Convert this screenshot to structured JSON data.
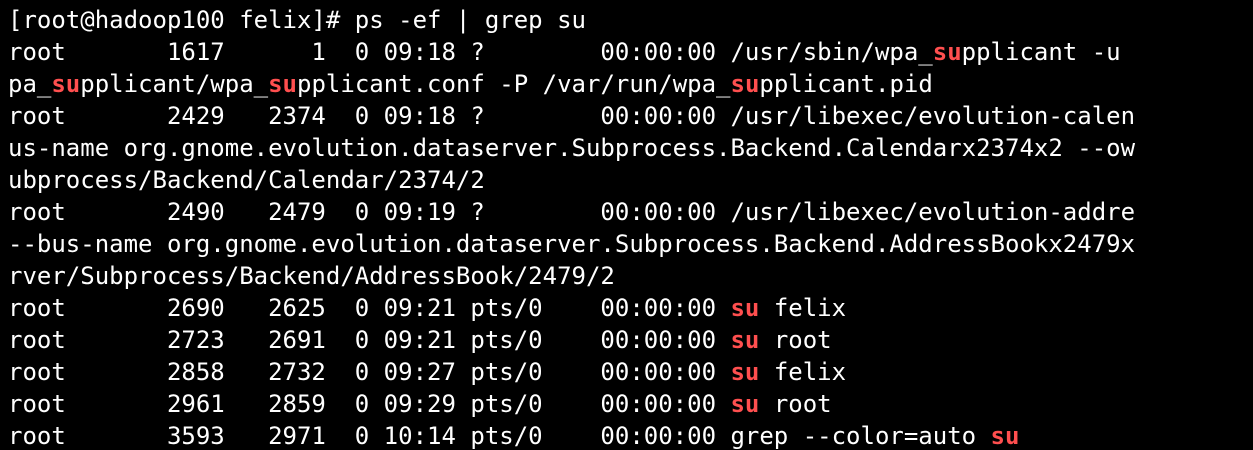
{
  "terminal": {
    "background_color": "#000000",
    "text_color": "#ffffff",
    "match_color": "#ff4f4f",
    "lines": [
      [
        {
          "t": "[root@hadoop100 felix]# ps -ef | grep su"
        }
      ],
      [
        {
          "t": "root       1617      1  0 09:18 ?        00:00:00 /usr/sbin/wpa_"
        },
        {
          "t": "su",
          "m": true
        },
        {
          "t": "pplicant -u"
        }
      ],
      [
        {
          "t": "pa_"
        },
        {
          "t": "su",
          "m": true
        },
        {
          "t": "pplicant/wpa_"
        },
        {
          "t": "su",
          "m": true
        },
        {
          "t": "pplicant.conf -P /var/run/wpa_"
        },
        {
          "t": "su",
          "m": true
        },
        {
          "t": "pplicant.pid"
        }
      ],
      [
        {
          "t": "root       2429   2374  0 09:18 ?        00:00:00 /usr/libexec/evolution-calen"
        }
      ],
      [
        {
          "t": "us-name org.gnome.evolution.dataserver.Subprocess.Backend.Calendarx2374x2 --ow"
        }
      ],
      [
        {
          "t": "ubprocess/Backend/Calendar/2374/2"
        }
      ],
      [
        {
          "t": "root       2490   2479  0 09:19 ?        00:00:00 /usr/libexec/evolution-addre"
        }
      ],
      [
        {
          "t": "--bus-name org.gnome.evolution.dataserver.Subprocess.Backend.AddressBookx2479x"
        }
      ],
      [
        {
          "t": "rver/Subprocess/Backend/AddressBook/2479/2"
        }
      ],
      [
        {
          "t": "root       2690   2625  0 09:21 pts/0    00:00:00 "
        },
        {
          "t": "su",
          "m": true
        },
        {
          "t": " felix"
        }
      ],
      [
        {
          "t": "root       2723   2691  0 09:21 pts/0    00:00:00 "
        },
        {
          "t": "su",
          "m": true
        },
        {
          "t": " root"
        }
      ],
      [
        {
          "t": "root       2858   2732  0 09:27 pts/0    00:00:00 "
        },
        {
          "t": "su",
          "m": true
        },
        {
          "t": " felix"
        }
      ],
      [
        {
          "t": "root       2961   2859  0 09:29 pts/0    00:00:00 "
        },
        {
          "t": "su",
          "m": true
        },
        {
          "t": " root"
        }
      ],
      [
        {
          "t": "root       3593   2971  0 10:14 pts/0    00:00:00 grep --color=auto "
        },
        {
          "t": "su",
          "m": true
        }
      ]
    ]
  }
}
